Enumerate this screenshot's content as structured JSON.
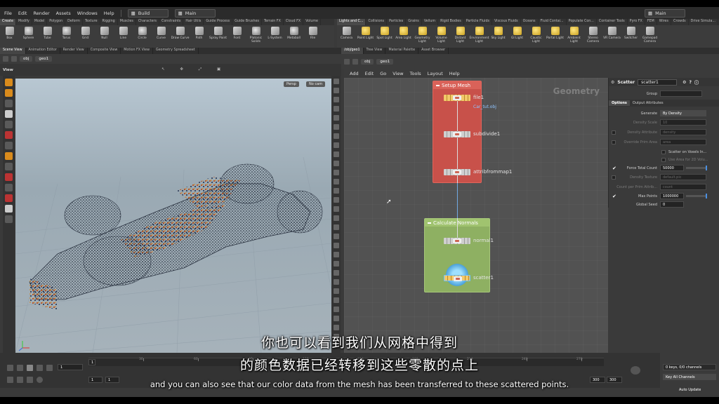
{
  "menu": {
    "items": [
      "File",
      "Edit",
      "Render",
      "Assets",
      "Windows",
      "Help"
    ],
    "build_desk": "Build",
    "main_desk": "Main",
    "right_desk": "Main"
  },
  "shelf_tabs_left": [
    "Create",
    "Modify",
    "Model",
    "Polygon",
    "Deform",
    "Texture",
    "Rigging",
    "Muscles",
    "Characters",
    "Constraints",
    "Hair Utils",
    "Guide Process",
    "Guide Brushes",
    "Terrain FX",
    "Cloud FX",
    "Volume"
  ],
  "shelf_tools_left": [
    "Box",
    "Sphere",
    "Tube",
    "Torus",
    "Grid",
    "Null",
    "Line",
    "Circle",
    "Curve",
    "Draw Curve",
    "Path",
    "Spray Paint",
    "Font",
    "Platonic Solids",
    "L-System",
    "Metaball",
    "File"
  ],
  "shelf_tabs_right": [
    "Lights and C...",
    "Collisions",
    "Particles",
    "Grains",
    "Vellum",
    "Rigid Bodies",
    "Particle Fluids",
    "Viscous Fluids",
    "Oceans",
    "Fluid Contai...",
    "Populate Con...",
    "Container Tools",
    "Pyro FX",
    "FEM",
    "Wires",
    "Crowds",
    "Drive Simula..."
  ],
  "shelf_tools_right": [
    "Camera",
    "Point Light",
    "Spot Light",
    "Area Light",
    "Geometry Light",
    "Volume Light",
    "Distant Light",
    "Environment Light",
    "Sky Light",
    "GI Light",
    "Caustic Light",
    "Portal Light",
    "Ambient Light",
    "Stereo Camera",
    "VR Camera",
    "Switcher",
    "Gamepad Camera"
  ],
  "left_pane_tabs": [
    "Scene View",
    "Animation Editor",
    "Render View",
    "Composite View",
    "Motion FX View",
    "Geometry Spreadsheet"
  ],
  "right_pane_tabs": [
    "/obj/geo1",
    "Tree View",
    "Material Palette",
    "Asset Browser"
  ],
  "path": {
    "obj": "obj",
    "geo": "geo1"
  },
  "viewport": {
    "label": "View",
    "persp": "Persp",
    "cam": "No cam"
  },
  "network_menu": [
    "Add",
    "Edit",
    "Go",
    "View",
    "Tools",
    "Layout",
    "Help"
  ],
  "network_context": "Geometry",
  "boxes": {
    "setup": "Setup Mesh",
    "calc": "Calculate Normals"
  },
  "nodes": {
    "file": "file1",
    "file_sub": "Car_tut.obj",
    "subdivide": "subdivide1",
    "attrib": "attribfrommap1",
    "normal": "normal1",
    "scatter": "scatter1"
  },
  "params": {
    "node_type": "Scatter",
    "node_name": "scatter1",
    "group_label": "Group",
    "tabs": [
      "Options",
      "Output Attributes"
    ],
    "generate_label": "Generate",
    "generate_value": "By Density",
    "density_scale_label": "Density Scale",
    "density_scale_value": "10",
    "density_attr_label": "Density Attribute",
    "density_attr_value": "density",
    "override_prim_label": "Override Prim Area",
    "override_prim_value": "area",
    "scatter_voxels": "Scatter on Voxels In...",
    "use_area": "Use Area for 2D Volu...",
    "force_total_label": "Force Total Count",
    "force_total_value": "50000",
    "density_texture_label": "Density Texture",
    "density_texture_value": "default.pic",
    "count_prim_label": "Count per Prim Attrib...",
    "count_prim_value": "count",
    "max_points_label": "Max Points",
    "max_points_value": "1000000",
    "global_seed_label": "Global Seed",
    "global_seed_value": "0"
  },
  "timeline": {
    "frame": "1",
    "start": "1",
    "end": "1",
    "ticks": [
      "30",
      "60",
      "90",
      "120",
      "150",
      "180",
      "210",
      "240",
      "270"
    ],
    "range_end_a": "300",
    "range_end_b": "300",
    "keys": "0 keys, 0/0 channels",
    "key_all": "Key All Channels",
    "auto_update": "Auto Update"
  },
  "subtitles": {
    "cn_line1": "你也可以看到我们从网格中得到",
    "cn_line2": "的颜色数据已经转移到这些零散的点上",
    "en": "and you can also see that our color data from the mesh has been transferred to these scattered points."
  }
}
